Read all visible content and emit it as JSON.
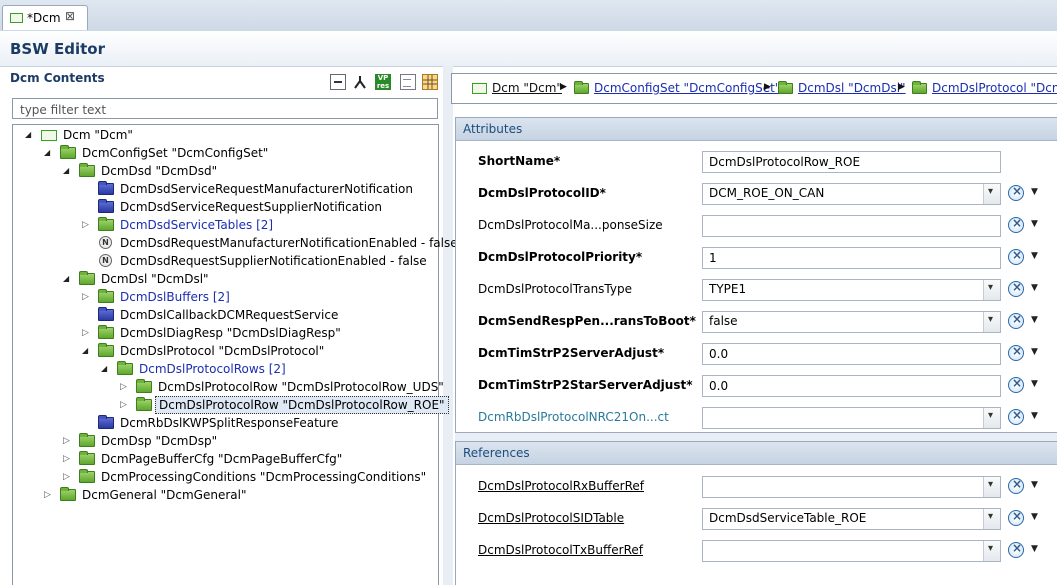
{
  "tab": {
    "label": "*Dcm",
    "close": "⊠"
  },
  "editor": {
    "title": "BSW Editor"
  },
  "left": {
    "header": "Dcm Contents",
    "filter_placeholder": "type filter text",
    "tools": [
      "collapse-all-icon",
      "link-editor-icon",
      "vp-res-icon",
      "document-icon",
      "grid-icon"
    ],
    "tree": [
      {
        "label": "Dcm \"Dcm\"",
        "icon": "module",
        "twisty": "open",
        "indent": 0
      },
      {
        "label": "DcmConfigSet \"DcmConfigSet\"",
        "icon": "folder",
        "twisty": "open",
        "indent": 1
      },
      {
        "label": "DcmDsd \"DcmDsd\"",
        "icon": "folder",
        "twisty": "open",
        "indent": 2
      },
      {
        "label": "DcmDsdServiceRequestManufacturerNotification",
        "icon": "blue",
        "twisty": "none",
        "indent": 3
      },
      {
        "label": "DcmDsdServiceRequestSupplierNotification",
        "icon": "blue",
        "twisty": "none",
        "indent": 3
      },
      {
        "label": "DcmDsdServiceTables [2]",
        "icon": "folder",
        "twisty": "closed",
        "indent": 3,
        "link": true
      },
      {
        "label": "DcmDsdRequestManufacturerNotificationEnabled - false",
        "icon": "n",
        "twisty": "none",
        "indent": 3
      },
      {
        "label": "DcmDsdRequestSupplierNotificationEnabled - false",
        "icon": "n",
        "twisty": "none",
        "indent": 3
      },
      {
        "label": "DcmDsl \"DcmDsl\"",
        "icon": "folder",
        "twisty": "open",
        "indent": 2
      },
      {
        "label": "DcmDslBuffers [2]",
        "icon": "folder",
        "twisty": "closed",
        "indent": 3,
        "link": true
      },
      {
        "label": "DcmDslCallbackDCMRequestService",
        "icon": "blue",
        "twisty": "none",
        "indent": 3
      },
      {
        "label": "DcmDslDiagResp \"DcmDslDiagResp\"",
        "icon": "folder",
        "twisty": "closed",
        "indent": 3
      },
      {
        "label": "DcmDslProtocol \"DcmDslProtocol\"",
        "icon": "folder",
        "twisty": "open",
        "indent": 3
      },
      {
        "label": "DcmDslProtocolRows [2]",
        "icon": "folder",
        "twisty": "open",
        "indent": 4,
        "link": true
      },
      {
        "label": "DcmDslProtocolRow \"DcmDslProtocolRow_UDS\"",
        "icon": "folder",
        "twisty": "closed",
        "indent": 5
      },
      {
        "label": "DcmDslProtocolRow \"DcmDslProtocolRow_ROE\"",
        "icon": "folder",
        "twisty": "closed",
        "indent": 5,
        "selected": true
      },
      {
        "label": "DcmRbDslKWPSplitResponseFeature",
        "icon": "blue",
        "twisty": "none",
        "indent": 3
      },
      {
        "label": "DcmDsp \"DcmDsp\"",
        "icon": "folder",
        "twisty": "closed",
        "indent": 2
      },
      {
        "label": "DcmPageBufferCfg \"DcmPageBufferCfg\"",
        "icon": "folder",
        "twisty": "closed",
        "indent": 2
      },
      {
        "label": "DcmProcessingConditions \"DcmProcessingConditions\"",
        "icon": "folder",
        "twisty": "closed",
        "indent": 2
      },
      {
        "label": "DcmGeneral \"DcmGeneral\"",
        "icon": "folder",
        "twisty": "closed",
        "indent": 1
      }
    ]
  },
  "breadcrumb": [
    {
      "label": "Dcm \"Dcm\"",
      "icon": "module",
      "dark": true
    },
    {
      "label": "DcmConfigSet \"DcmConfigSet\"",
      "icon": "folder"
    },
    {
      "label": "DcmDsl \"DcmDsl\"",
      "icon": "folder"
    },
    {
      "label": "DcmDslProtocol \"DcmDslProtocol\"",
      "icon": "folder"
    }
  ],
  "attributes": {
    "title": "Attributes",
    "rows": [
      {
        "label": "ShortName*",
        "value": "DcmDslProtocolRow_ROE",
        "bold": true,
        "type": "text",
        "actions": false
      },
      {
        "label": "DcmDslProtocolID*",
        "value": "DCM_ROE_ON_CAN",
        "bold": true,
        "type": "combo",
        "actions": true
      },
      {
        "label": "DcmDslProtocolMa...ponseSize",
        "value": "",
        "bold": false,
        "type": "text",
        "actions": true
      },
      {
        "label": "DcmDslProtocolPriority*",
        "value": "1",
        "bold": true,
        "type": "text",
        "actions": true
      },
      {
        "label": "DcmDslProtocolTransType",
        "value": "TYPE1",
        "bold": false,
        "type": "combo",
        "actions": true
      },
      {
        "label": "DcmSendRespPen...ransToBoot*",
        "value": "false",
        "bold": true,
        "type": "combo",
        "actions": true
      },
      {
        "label": "DcmTimStrP2ServerAdjust*",
        "value": "0.0",
        "bold": true,
        "type": "text",
        "actions": true
      },
      {
        "label": "DcmTimStrP2StarServerAdjust*",
        "value": "0.0",
        "bold": true,
        "type": "text",
        "actions": true
      },
      {
        "label": "DcmRbDslProtocolNRC21On...ct",
        "value": "",
        "bold": false,
        "teal": true,
        "type": "combo",
        "actions": true
      }
    ]
  },
  "references": {
    "title": "References",
    "rows": [
      {
        "label": "DcmDslProtocolRxBufferRef",
        "value": "",
        "type": "combo"
      },
      {
        "label": "DcmDslProtocolSIDTable",
        "value": "DcmDsdServiceTable_ROE",
        "type": "combo"
      },
      {
        "label": "DcmDslProtocolTxBufferRef",
        "value": "",
        "type": "combo"
      }
    ]
  },
  "colors": {
    "accent": "#1c3c64",
    "link": "#1a2eb0",
    "folder": "#5ea72e",
    "element": "#2c3aa0"
  }
}
